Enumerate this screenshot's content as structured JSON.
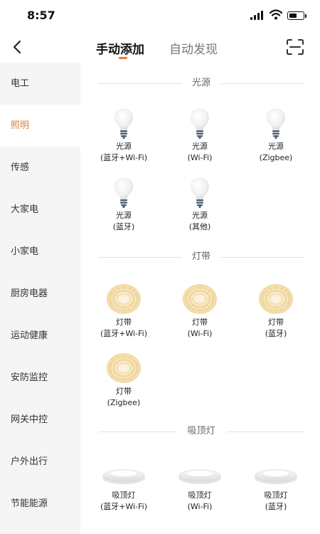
{
  "status_bar": {
    "time": "8:57"
  },
  "header": {
    "tabs": [
      {
        "label": "手动添加",
        "active": true
      },
      {
        "label": "自动发现",
        "active": false
      }
    ],
    "accent_color": "#f0793c"
  },
  "sidebar": {
    "active_color": "#d9823b",
    "items": [
      {
        "label": "电工",
        "active": false
      },
      {
        "label": "照明",
        "active": true
      },
      {
        "label": "传感",
        "active": false
      },
      {
        "label": "大家电",
        "active": false
      },
      {
        "label": "小家电",
        "active": false
      },
      {
        "label": "厨房电器",
        "active": false
      },
      {
        "label": "运动健康",
        "active": false
      },
      {
        "label": "安防监控",
        "active": false
      },
      {
        "label": "网关中控",
        "active": false
      },
      {
        "label": "户外出行",
        "active": false
      },
      {
        "label": "节能能源",
        "active": false
      }
    ]
  },
  "sections": [
    {
      "title": "光源",
      "icon": "light-bulb-icon",
      "devices": [
        {
          "line1": "光源",
          "line2": "(蓝牙+Wi-Fi)"
        },
        {
          "line1": "光源",
          "line2": "(Wi-Fi)"
        },
        {
          "line1": "光源",
          "line2": "(Zigbee)"
        },
        {
          "line1": "光源",
          "line2": "(蓝牙)"
        },
        {
          "line1": "光源",
          "line2": "(其他)"
        }
      ]
    },
    {
      "title": "灯带",
      "icon": "light-strip-icon",
      "devices": [
        {
          "line1": "灯带",
          "line2": "(蓝牙+Wi-Fi)"
        },
        {
          "line1": "灯带",
          "line2": "(Wi-Fi)"
        },
        {
          "line1": "灯带",
          "line2": "(蓝牙)"
        },
        {
          "line1": "灯带",
          "line2": "(Zigbee)"
        }
      ]
    },
    {
      "title": "吸顶灯",
      "icon": "ceiling-light-icon",
      "devices": [
        {
          "line1": "吸顶灯",
          "line2": "(蓝牙+Wi-Fi)"
        },
        {
          "line1": "吸顶灯",
          "line2": "(Wi-Fi)"
        },
        {
          "line1": "吸顶灯",
          "line2": "(蓝牙)"
        }
      ]
    }
  ]
}
